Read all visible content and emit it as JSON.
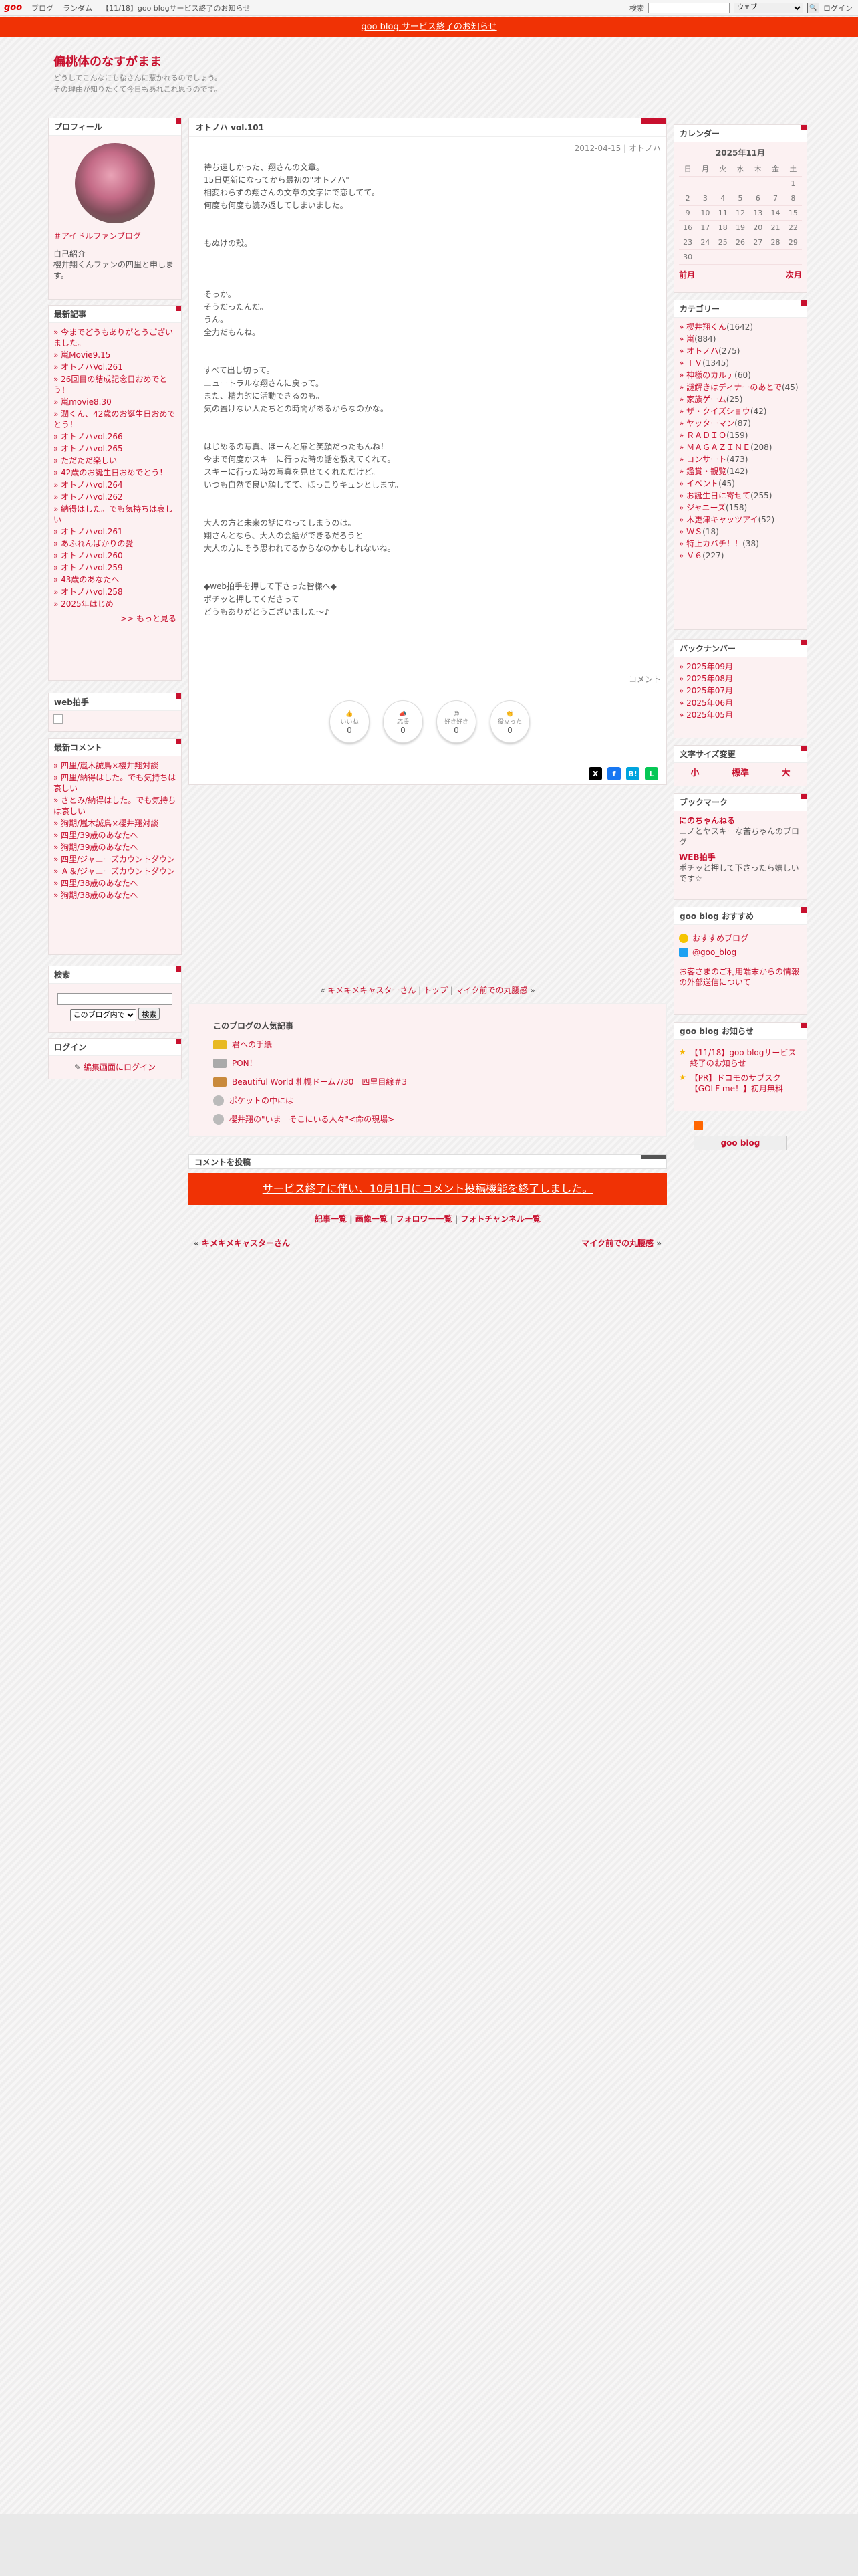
{
  "topbar": {
    "logo": "goo",
    "links": [
      "ブログ",
      "ランダム",
      "【11/18】goo blogサービス終了のお知らせ"
    ],
    "search_label": "検索",
    "search_select": "ウェブ",
    "login": "ログイン"
  },
  "banner": {
    "text": "goo blog サービス終了のお知らせ"
  },
  "blog": {
    "title": "偏桃体のなすがまま",
    "desc1": "どうしてこんなにも桜さんに惹かれるのでしょう。",
    "desc2": "その理由が知りたくて今日もあれこれ思うのです。"
  },
  "profile": {
    "title": "プロフィール",
    "tag": "＃アイドルファンブログ",
    "intro_label": "自己紹介",
    "intro": "櫻井翔くんファンの四里と申します。"
  },
  "recent": {
    "title": "最新記事",
    "items": [
      "今までどうもありがとうございました。",
      "嵐Movie9.15",
      "オトノハVol.261",
      "26回目の結成記念日おめでとう！",
      "嵐movie8.30",
      "潤くん、42歳のお誕生日おめでとう！",
      "オトノハvol.266",
      "オトノハvol.265",
      "ただただ楽しい",
      "42歳のお誕生日おめでとう！",
      "オトノハvol.264",
      "オトノハvol.262",
      "納得はした。でも気持ちは哀しい",
      "オトノハvol.261",
      "あふれんばかりの愛",
      "オトノハvol.260",
      "オトノハvol.259",
      "43歳のあなたへ",
      "オトノハvol.258",
      "2025年はじめ"
    ],
    "more": ">> もっと見る"
  },
  "webclap": {
    "title": "web拍手"
  },
  "comments": {
    "title": "最新コメント",
    "items": [
      "四里/嵐木誠鳥×櫻井翔対談",
      "四里/納得はした。でも気持ちは哀しい",
      "さとみ/納得はした。でも気持ちは哀しい",
      "狗期/嵐木誠鳥×櫻井翔対談",
      "四里/39歳のあなたへ",
      "狗期/39歳のあなたへ",
      "四里/ジャニーズカウントダウン",
      "Ａ＆/ジャニーズカウントダウン",
      "四里/38歳のあなたへ",
      "狗期/38歳のあなたへ"
    ]
  },
  "search": {
    "title": "検索",
    "scope": "このブログ内で",
    "button": "検索"
  },
  "login": {
    "title": "ログイン",
    "link": "編集画面にログイン"
  },
  "article": {
    "title": "オトノハ vol.101",
    "date": "2012-04-15",
    "category": "オトノハ",
    "paragraphs": [
      "待ち遠しかった、翔さんの文章。",
      "15日更新になってから最初の\"オトノハ\"",
      "相変わらずの翔さんの文章の文字にで恋してて。",
      "何度も何度も読み返してしまいました。",
      "",
      "",
      "もぬけの殻。",
      "",
      "",
      "",
      "そっか。",
      "そうだったんだ。",
      "うん。",
      "全力だもんね。",
      "",
      "",
      "すべて出し切って。",
      "ニュートラルな翔さんに戻って。",
      "また、精力的に活動できるのも。",
      "気の置けない人たちとの時間があるからなのかな。",
      "",
      "",
      "はじめるの写真、ほーんと扉と笑顔だったもんね！",
      "今まで何度かスキーに行った時の話を教えてくれて。",
      "スキーに行った時の写真を見せてくれただけど。",
      "いつも自然で良い顔してて、ほっこりキュンとします。",
      "",
      "",
      "大人の方と未来の話になってしまうのは。",
      "翔さんとなら、大人の会話ができるだろうと",
      "大人の方にそう思われてるからなのかもしれないね。",
      "",
      "",
      "◆web拍手を押して下さった皆様へ◆",
      "ポチッと押してくださって",
      "どうもありがとうございました〜♪"
    ],
    "comment_link": "コメント",
    "reactions": [
      {
        "label": "いいね",
        "count": "0"
      },
      {
        "label": "応援",
        "count": "0"
      },
      {
        "label": "好き好き",
        "count": "0"
      },
      {
        "label": "役立った",
        "count": "0"
      }
    ]
  },
  "nav": {
    "prev": "キメキメキャスターさん",
    "top": "トップ",
    "next": "マイク前での丸腰感"
  },
  "popular": {
    "title": "このブログの人気記事",
    "items": [
      "君への手紙",
      "PON！",
      "Beautiful World 札幌ドーム7/30　四里目線＃3",
      "ポケットの中には",
      "櫻井翔の\"いま　そこにいる人々\"<命の現場>"
    ]
  },
  "comment_form": {
    "title": "コメントを投稿",
    "banner": "サービス終了に伴い、10月1日にコメント投稿機能を終了しました。"
  },
  "footlinks": [
    "記事一覧",
    "画像一覧",
    "フォロワー一覧",
    "フォトチャンネル一覧"
  ],
  "prevnext": {
    "prev": "キメキメキャスターさん",
    "next": "マイク前での丸腰感"
  },
  "calendar": {
    "title": "カレンダー",
    "month": "2025年11月",
    "days": [
      "日",
      "月",
      "火",
      "水",
      "木",
      "金",
      "土"
    ],
    "weeks": [
      [
        "",
        "",
        "",
        "",
        "",
        "",
        "1"
      ],
      [
        "2",
        "3",
        "4",
        "5",
        "6",
        "7",
        "8"
      ],
      [
        "9",
        "10",
        "11",
        "12",
        "13",
        "14",
        "15"
      ],
      [
        "16",
        "17",
        "18",
        "19",
        "20",
        "21",
        "22"
      ],
      [
        "23",
        "24",
        "25",
        "26",
        "27",
        "28",
        "29"
      ],
      [
        "30",
        "",
        "",
        "",
        "",
        "",
        ""
      ]
    ],
    "prev": "前月",
    "next": "次月"
  },
  "categories": {
    "title": "カテゴリー",
    "items": [
      {
        "name": "櫻井翔くん",
        "count": "(1642)"
      },
      {
        "name": "嵐",
        "count": "(884)"
      },
      {
        "name": "オトノハ",
        "count": "(275)"
      },
      {
        "name": "ＴＶ",
        "count": "(1345)"
      },
      {
        "name": "神様のカルテ",
        "count": "(60)"
      },
      {
        "name": "謎解きはディナーのあとで",
        "count": "(45)"
      },
      {
        "name": "家族ゲーム",
        "count": "(25)"
      },
      {
        "name": "ザ・クイズショウ",
        "count": "(42)"
      },
      {
        "name": "ヤッターマン",
        "count": "(87)"
      },
      {
        "name": "ＲＡＤＩＯ",
        "count": "(159)"
      },
      {
        "name": "ＭＡＧＡＺＩＮＥ",
        "count": "(208)"
      },
      {
        "name": "コンサート",
        "count": "(473)"
      },
      {
        "name": "鑑賞・観覧",
        "count": "(142)"
      },
      {
        "name": "イベント",
        "count": "(45)"
      },
      {
        "name": "お誕生日に寄せて",
        "count": "(255)"
      },
      {
        "name": "ジャニーズ",
        "count": "(158)"
      },
      {
        "name": "木更津キャッツアイ",
        "count": "(52)"
      },
      {
        "name": "ＷＳ",
        "count": "(18)"
      },
      {
        "name": "特上カバチ！！",
        "count": "(38)"
      },
      {
        "name": "Ｖ６",
        "count": "(227)"
      }
    ]
  },
  "backnumber": {
    "title": "バックナンバー",
    "items": [
      "2025年09月",
      "2025年08月",
      "2025年07月",
      "2025年06月",
      "2025年05月"
    ]
  },
  "fontsize": {
    "title": "文字サイズ変更",
    "small": "小",
    "normal": "標準",
    "large": "大"
  },
  "bookmark": {
    "title": "ブックマーク",
    "items": [
      {
        "name": "にのちゃんねる",
        "desc": "ニノとヤスキーな苦ちゃんのブログ"
      },
      {
        "name": "WEB拍手",
        "desc": "ポチッと押して下さったら嬉しいです☆"
      }
    ]
  },
  "goorec": {
    "title": "goo blog おすすめ",
    "recommend": "おすすめブログ",
    "twitter": "@goo_blog",
    "notice": "お客さまのご利用端末からの情報の外部送信について"
  },
  "goonews": {
    "title": "goo blog お知らせ",
    "items": [
      "【11/18】goo blogサービス終了のお知らせ",
      "【PR】ドコモのサブスク【GOLF me！】初月無料"
    ]
  },
  "footer_logo": "goo blog"
}
